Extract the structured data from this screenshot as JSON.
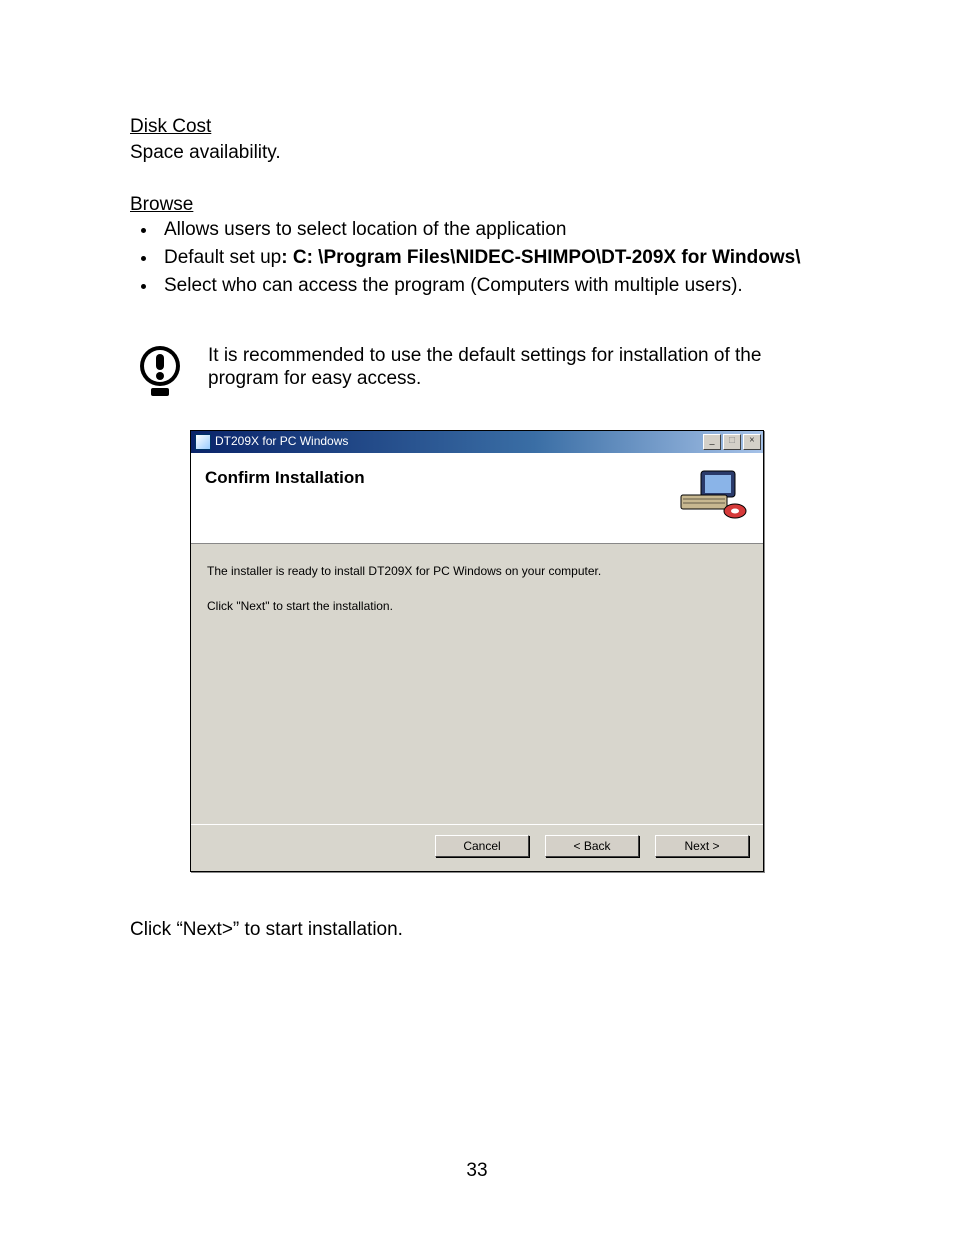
{
  "doc": {
    "disk_cost_heading": "Disk Cost",
    "disk_cost_text": "Space availability.",
    "browse_heading": "Browse",
    "bullets": {
      "b1": "Allows users to select location of the application",
      "b2_prefix": "Default set up",
      "b2_bold": ": C: \\Program Files\\NIDEC-SHIMPO\\DT-209X for Windows\\",
      "b3": "Select who can access the program (Computers with multiple users)."
    },
    "note": "It is recommended to use the default settings for installation of the program for easy access.",
    "after_text": "Click “Next>” to start installation.",
    "page_number": "33"
  },
  "installer": {
    "title": "DT209X for PC Windows",
    "minimize": "_",
    "maximize": "□",
    "close": "×",
    "banner_title": "Confirm Installation",
    "body_line1": "The installer is ready to install DT209X for PC Windows on your computer.",
    "body_line2": "Click \"Next\" to start the installation.",
    "btn_cancel": "Cancel",
    "btn_back": "< Back",
    "btn_next": "Next >"
  }
}
